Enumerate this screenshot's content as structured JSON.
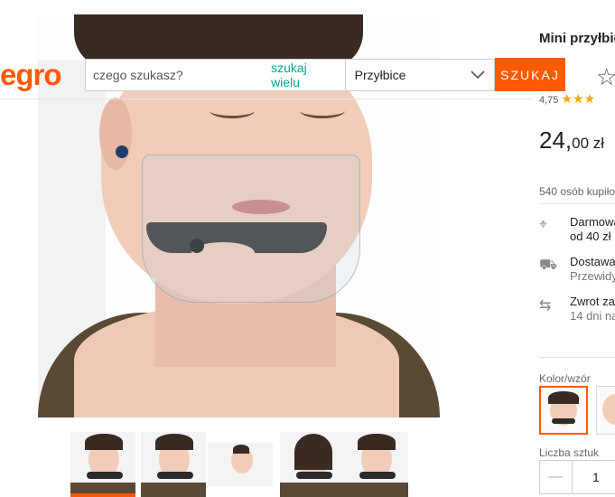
{
  "header": {
    "logo_text": "egro",
    "search_placeholder": "czego szukasz?",
    "search_many": "szukaj wielu",
    "category": "Przyłbice",
    "search_button": "SZUKAJ",
    "accent": "#ff5a00",
    "link_color": "#00a790"
  },
  "product": {
    "title": "Mini przyłbic",
    "rating_value": "4,75",
    "price_main": "24,",
    "price_cents": "00 zł",
    "bought": "540 osób kupiło",
    "delivery_free": "Darmowa",
    "delivery_free_sub": "od 40 zł (",
    "delivery": "Dostawa",
    "delivery_sub": "Przewidy",
    "returns": "Zwrot za",
    "returns_sub": "14 dni na",
    "color_label": "Kolor/wzór",
    "quantity_label": "Liczba sztuk",
    "quantity_value": "1",
    "minus": "—"
  },
  "thumbnails": [
    {
      "name": "thumbnail-1",
      "active": true
    },
    {
      "name": "thumbnail-2",
      "active": false
    },
    {
      "name": "thumbnail-3",
      "active": false
    },
    {
      "name": "thumbnail-4",
      "active": false
    },
    {
      "name": "thumbnail-5",
      "active": false
    }
  ],
  "icons": {
    "favorite": "star-outline-icon",
    "dropdown": "chevron-down-icon",
    "location": "map-pin-icon",
    "truck": "truck-icon",
    "return": "return-icon"
  }
}
